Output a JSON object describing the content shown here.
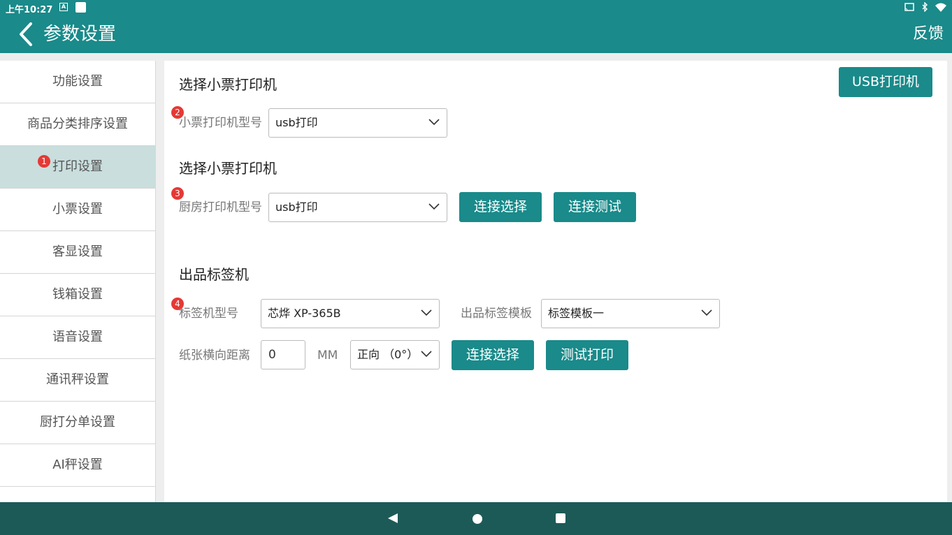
{
  "status": {
    "time": "上午10:27",
    "a_icon": "A"
  },
  "appbar": {
    "title": "参数设置",
    "feedback": "反馈"
  },
  "sidebar": {
    "items": [
      {
        "label": "功能设置"
      },
      {
        "label": "商品分类排序设置"
      },
      {
        "label": "打印设置",
        "badge": "1"
      },
      {
        "label": "小票设置"
      },
      {
        "label": "客显设置"
      },
      {
        "label": "钱箱设置"
      },
      {
        "label": "语音设置"
      },
      {
        "label": "通讯秤设置"
      },
      {
        "label": "厨打分单设置"
      },
      {
        "label": "AI秤设置"
      }
    ]
  },
  "main": {
    "usb_button": "USB打印机",
    "receipt": {
      "title": "选择小票打印机",
      "badge": "2",
      "label": "小票打印机型号",
      "value": "usb打印"
    },
    "kitchen": {
      "title": "选择小票打印机",
      "badge": "3",
      "label": "厨房打印机型号",
      "value": "usb打印",
      "connect_button": "连接选择",
      "test_button": "连接测试"
    },
    "label_printer": {
      "title": "出品标签机",
      "badge": "4",
      "model_label": "标签机型号",
      "model_value": "芯烨 XP-365B",
      "template_label": "出品标签模板",
      "template_value": "标签模板一",
      "distance_label": "纸张横向距离",
      "distance_value": "0",
      "unit": "MM",
      "direction_value": "正向 （0°）",
      "connect_button": "连接选择",
      "test_button": "测试打印"
    }
  },
  "colors": {
    "primary": "#1a8a8a",
    "navbar": "#1c5a58",
    "badge": "#e53935",
    "active_item": "#c9dedd"
  }
}
